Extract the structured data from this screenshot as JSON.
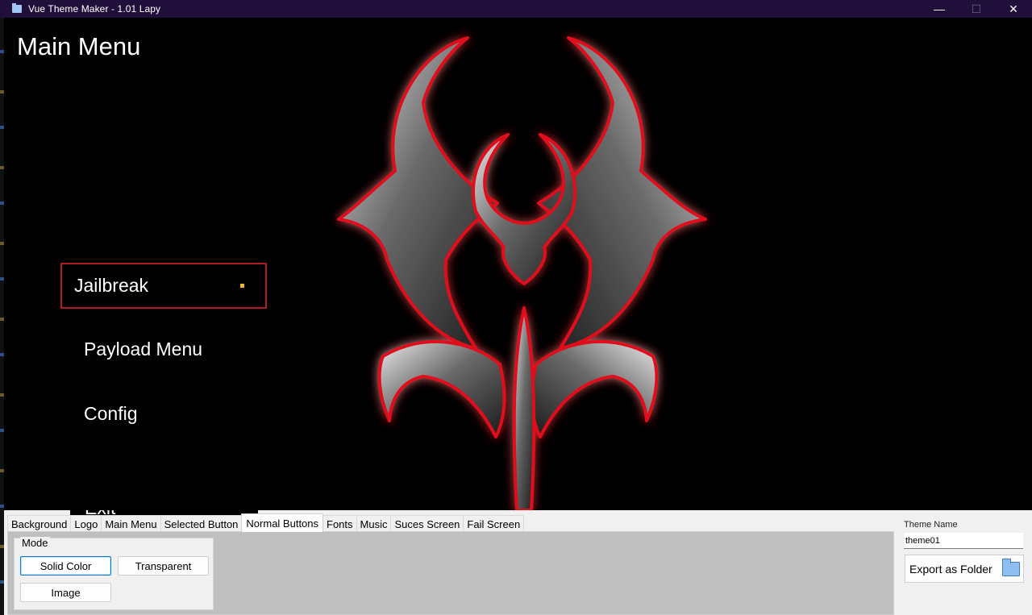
{
  "window": {
    "title": "Vue Theme Maker - 1.01  Lapy",
    "minimize": "—",
    "maximize": "☐",
    "close": "✕"
  },
  "preview": {
    "title": "Main Menu",
    "buttons": [
      {
        "label": "Jailbreak",
        "state": "selected"
      },
      {
        "label": "Payload Menu",
        "state": "normal"
      },
      {
        "label": "Config",
        "state": "normal"
      },
      {
        "label": "Exit",
        "state": "normal"
      }
    ],
    "colors": {
      "selected_border": "#b01c25",
      "cursor": "#f0b530",
      "text": "#ffffff",
      "emblem_glow": "#e0101a"
    }
  },
  "editor": {
    "tabs": [
      {
        "label": "Background",
        "active": false
      },
      {
        "label": "Logo",
        "active": false
      },
      {
        "label": "Main Menu",
        "active": false
      },
      {
        "label": "Selected Button",
        "active": false
      },
      {
        "label": "Normal Buttons",
        "active": true
      },
      {
        "label": "Fonts",
        "active": false
      },
      {
        "label": "Music",
        "active": false
      },
      {
        "label": "Suces Screen",
        "active": false
      },
      {
        "label": "Fail Screen",
        "active": false
      }
    ],
    "mode": {
      "legend": "Mode",
      "solid_color": "Solid Color",
      "transparent": "Transparent",
      "image": "Image"
    },
    "theme_name_label": "Theme Name",
    "theme_name_value": "theme01",
    "export_label": "Export as Folder",
    "export_icon": "folder-icon"
  }
}
